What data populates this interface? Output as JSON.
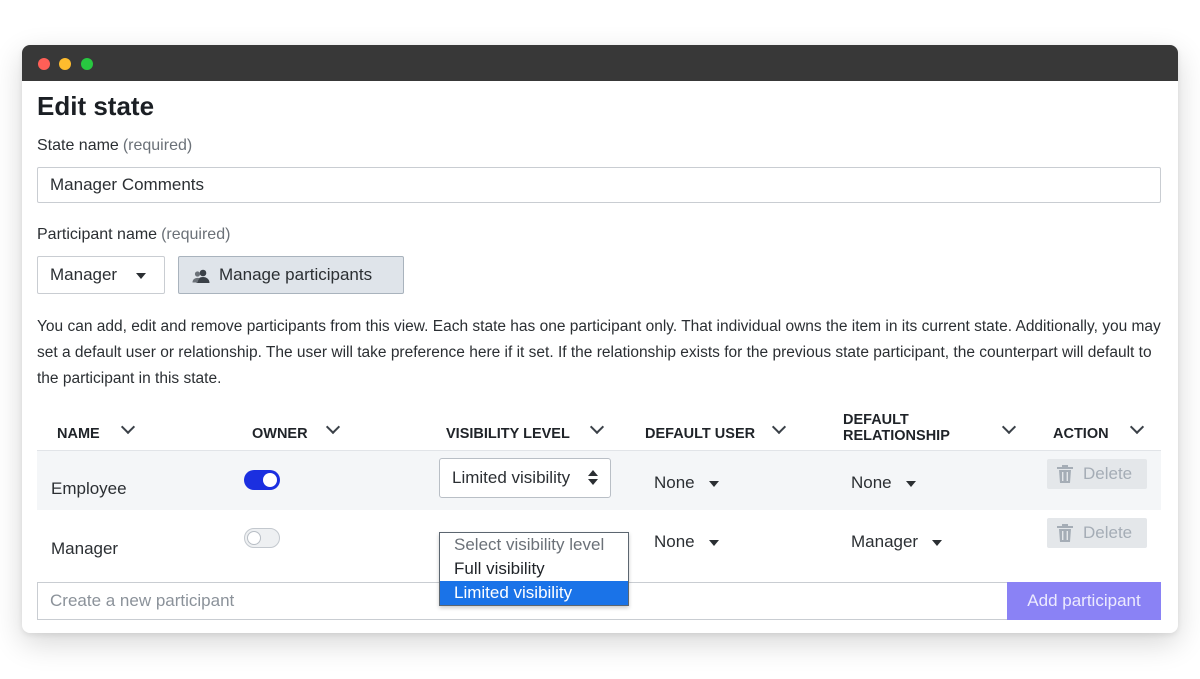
{
  "page": {
    "title": "Edit state",
    "state_name_label": "State name",
    "state_name_required": "(required)",
    "state_name_value": "Manager Comments",
    "participant_name_label": "Participant name",
    "participant_name_required": "(required)",
    "participant_select_value": "Manager",
    "manage_participants_label": "Manage participants",
    "description": "You can add, edit and remove participants from this view. Each state has one participant only. That individual owns the item in its current state. Additionally, you may set a default user or relationship. The user will take preference here if it set. If the relationship exists for the previous state participant, the counterpart will default to the participant in this state."
  },
  "table": {
    "headers": {
      "name": "NAME",
      "owner": "OWNER",
      "visibility": "VISIBILITY LEVEL",
      "default_user": "DEFAULT USER",
      "default_relationship_1": "DEFAULT",
      "default_relationship_2": "RELATIONSHIP",
      "action": "ACTION"
    },
    "rows": [
      {
        "name": "Employee",
        "owner": true,
        "visibility": "Limited visibility",
        "default_user": "None",
        "default_relationship": "None",
        "action": "Delete"
      },
      {
        "name": "Manager",
        "owner": false,
        "visibility": "",
        "default_user": "None",
        "default_relationship": "Manager",
        "action": "Delete"
      }
    ],
    "visibility_options": [
      "Select visibility level",
      "Full visibility",
      "Limited visibility"
    ],
    "visibility_selected": "Limited visibility"
  },
  "footer": {
    "new_participant_placeholder": "Create a new participant",
    "add_button_label": "Add participant"
  },
  "colors": {
    "toggle_on": "#1b2fe0",
    "add_button": "#8a82f5",
    "dropdown_selected": "#1a73e8",
    "titlebar": "#383838"
  }
}
